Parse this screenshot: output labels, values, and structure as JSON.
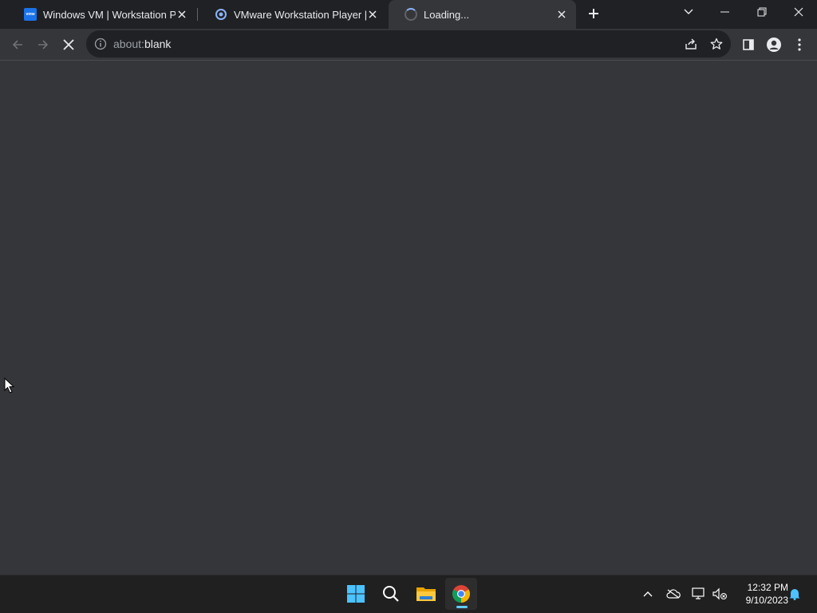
{
  "browser": {
    "tabs": [
      {
        "title": "Windows VM | Workstation Pro |",
        "favicon": "vmware-icon",
        "active": false
      },
      {
        "title": "VMware Workstation Player | VM",
        "favicon": "vmware-player-icon",
        "active": false
      },
      {
        "title": "Loading...",
        "favicon": "loading-spinner-icon",
        "active": true
      }
    ],
    "address": {
      "scheme": "about:",
      "host": "blank"
    },
    "favicon_vmw_text": "vmw"
  },
  "taskbar": {
    "clock_time": "12:32 PM",
    "clock_date": "9/10/2023"
  },
  "colors": {
    "content_bg": "#35363a",
    "titlebar_bg": "#202124",
    "taskbar_bg": "#202020",
    "accent": "#8ab4f8"
  }
}
